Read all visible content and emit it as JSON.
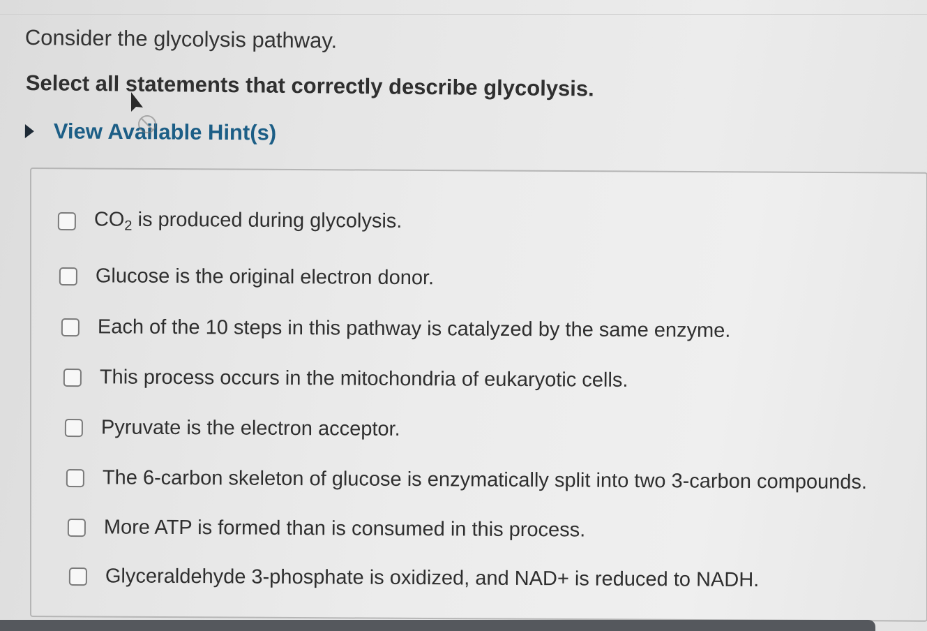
{
  "question": {
    "intro": "Consider the glycolysis pathway.",
    "prompt": "Select all statements that correctly describe glycolysis.",
    "hint_label": "View Available Hint(s)"
  },
  "options": [
    {
      "prefix": "CO",
      "subscript": "2",
      "text": " is produced during glycolysis."
    },
    {
      "text": "Glucose is the original electron donor."
    },
    {
      "text": "Each of the 10 steps in this pathway is catalyzed by the same enzyme."
    },
    {
      "text": "This process occurs in the mitochondria of eukaryotic cells."
    },
    {
      "text": "Pyruvate is the electron acceptor."
    },
    {
      "text": "The 6-carbon skeleton of glucose is enzymatically split into two 3-carbon compounds."
    },
    {
      "text": "More ATP is formed than is consumed in this process."
    },
    {
      "text": "Glyceraldehyde 3-phosphate is oxidized, and NAD+ is reduced to NADH."
    }
  ],
  "icons": {
    "hint_toggle": "triangle-right-icon",
    "cursor": "arrow-cursor-icon"
  },
  "colors": {
    "hint_link": "#1c5e86",
    "text": "#2e2e2e",
    "checkbox_border": "#7a7a7a"
  }
}
